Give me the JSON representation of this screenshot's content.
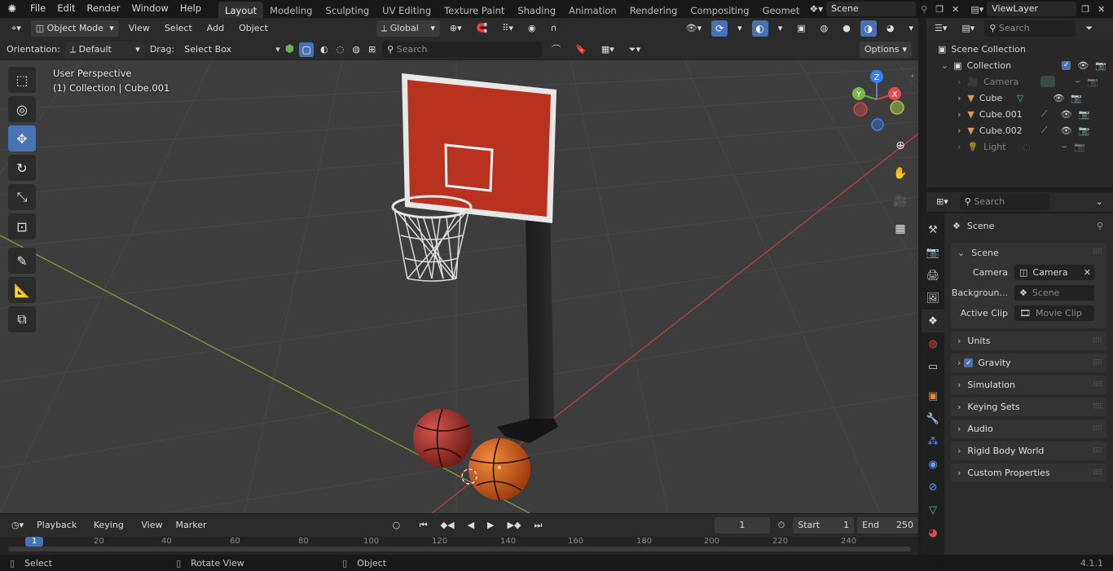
{
  "menubar": {
    "items": [
      "File",
      "Edit",
      "Render",
      "Window",
      "Help"
    ],
    "workspaces": [
      "Layout",
      "Modeling",
      "Sculpting",
      "UV Editing",
      "Texture Paint",
      "Shading",
      "Animation",
      "Rendering",
      "Compositing",
      "Geomet"
    ],
    "active_workspace": "Layout",
    "scene": "Scene",
    "view_layer": "ViewLayer"
  },
  "viewport_header": {
    "mode": "Object Mode",
    "menus": [
      "View",
      "Select",
      "Add",
      "Object"
    ],
    "transform_orientation": "Global"
  },
  "tool_header": {
    "orientation_label": "Orientation:",
    "orientation_value": "Default",
    "drag_label": "Drag:",
    "drag_value": "Select Box",
    "search_placeholder": "Search",
    "options_label": "Options"
  },
  "viewport": {
    "perspective": "User Perspective",
    "context": "(1) Collection | Cube.001",
    "gizmo_axes": [
      "Z",
      "Y",
      "X"
    ]
  },
  "timeline": {
    "menus": [
      "Playback",
      "Keying",
      "View",
      "Marker"
    ],
    "current_frame": "1",
    "start_label": "Start",
    "start": "1",
    "end_label": "End",
    "end": "250",
    "ticks": [
      "1",
      "20",
      "40",
      "60",
      "80",
      "100",
      "120",
      "140",
      "160",
      "180",
      "200",
      "220",
      "240"
    ]
  },
  "statusbar": {
    "select": "Select",
    "rotate": "Rotate View",
    "object": "Object",
    "version": "4.1.1"
  },
  "outliner": {
    "search_placeholder": "Search",
    "root": "Scene Collection",
    "collection": "Collection",
    "items": [
      {
        "name": "Camera",
        "dim": true
      },
      {
        "name": "Cube",
        "dim": false
      },
      {
        "name": "Cube.001",
        "dim": false
      },
      {
        "name": "Cube.002",
        "dim": false
      },
      {
        "name": "Light",
        "dim": true
      }
    ]
  },
  "properties": {
    "search_placeholder": "Search",
    "context": "Scene",
    "panel_title": "Scene",
    "camera_label": "Camera",
    "camera_value": "Camera",
    "background_label": "Backgroun...",
    "background_placeholder": "Scene",
    "clip_label": "Active Clip",
    "clip_placeholder": "Movie Clip",
    "sections": [
      "Units",
      "Gravity",
      "Simulation",
      "Keying Sets",
      "Audio",
      "Rigid Body World",
      "Custom Properties"
    ]
  },
  "colors": {
    "accent": "#4772b3",
    "backboard": "#b8321f",
    "ball_left": "#a8322a",
    "ball_right": "#d4611f"
  }
}
